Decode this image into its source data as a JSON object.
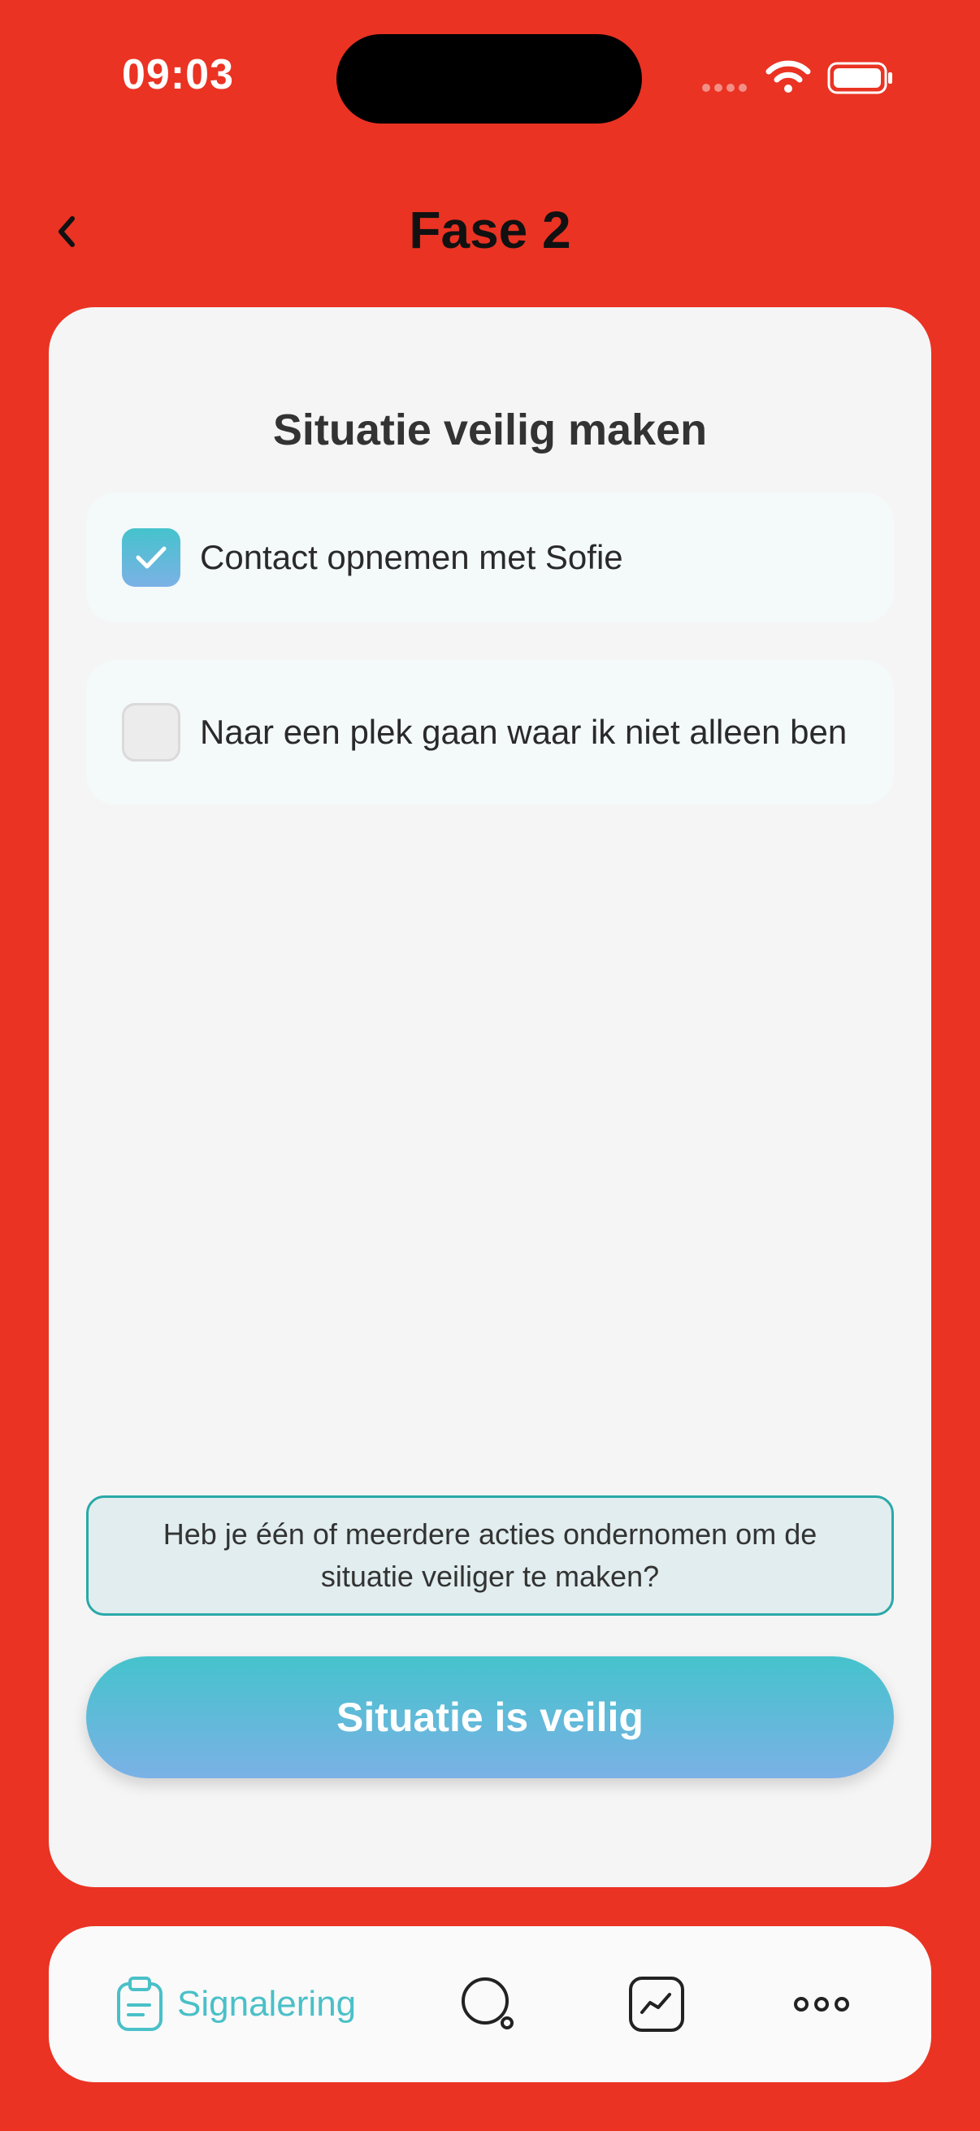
{
  "status_bar": {
    "time": "09:03",
    "icons": [
      "signal-dots-icon",
      "wifi-icon",
      "battery-icon"
    ]
  },
  "nav": {
    "back_icon": "chevron-left-icon",
    "title": "Fase 2"
  },
  "card": {
    "title": "Situatie veilig maken",
    "options": [
      {
        "label": "Contact opnemen met Sofie",
        "checked": true
      },
      {
        "label": "Naar een plek gaan waar ik niet alleen ben",
        "checked": false
      }
    ],
    "question": "Heb je één of meerdere acties ondernomen om de situatie veiliger te maken?",
    "button_label": "Situatie is veilig"
  },
  "tab_bar": {
    "items": [
      {
        "icon": "clipboard-icon",
        "label": "Signalering",
        "active": true
      },
      {
        "icon": "search-icon",
        "label": ""
      },
      {
        "icon": "chart-icon",
        "label": ""
      },
      {
        "icon": "more-icon",
        "label": ""
      }
    ]
  },
  "colors": {
    "background": "#EA3323",
    "accent": "#4AC0C8",
    "accent_gradient_end": "#7BB1E6",
    "card": "#F5F5F5"
  }
}
